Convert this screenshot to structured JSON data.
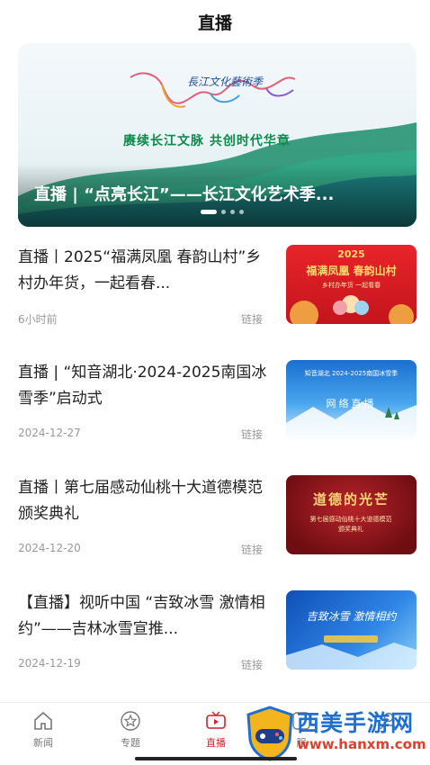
{
  "header": {
    "title": "直播"
  },
  "banner": {
    "caption": "直播 | “点亮长江”——长江文化艺术季...",
    "slogan": "赓续长江文脉  共创时代华章",
    "logo_text": "長江文化藝術季",
    "slide_count": 4,
    "active_slide": 1
  },
  "news": [
    {
      "title": "直播丨2025“福满凤凰 春韵山村”乡村办年货，一起看春...",
      "time": "6小时前",
      "tag": "链接",
      "thumb": {
        "headline": "福满凤凰 春韵山村",
        "year": "2025",
        "sub": "乡村办年货  一起看春",
        "theme": "red-festival"
      }
    },
    {
      "title": "直播 | “知音湖北·2024-2025南国冰雪季”启动式",
      "time": "2024-12-27",
      "tag": "链接",
      "thumb": {
        "headline": "知音湖北  2024-2025南国冰雪季",
        "sub": "网络直播",
        "theme": "blue-snow"
      }
    },
    {
      "title": "直播丨第七届感动仙桃十大道德模范颁奖典礼",
      "time": "2024-12-20",
      "tag": "链接",
      "thumb": {
        "headline": "道德的光芒",
        "sub": "第七届感动仙桃十大道德模范 颁奖典礼",
        "theme": "dark-red-stage"
      }
    },
    {
      "title": "【直播】视听中国 “吉致冰雪 激情相约”——吉林冰雪宣推...",
      "time": "2024-12-19",
      "tag": "链接",
      "thumb": {
        "headline": "吉致冰雪 激情相约",
        "sub": "",
        "theme": "blue-ice"
      }
    }
  ],
  "tabbar": {
    "items": [
      {
        "label": "新闻",
        "icon": "home-icon",
        "active": false
      },
      {
        "label": "专题",
        "icon": "star-icon",
        "active": false
      },
      {
        "label": "直播",
        "icon": "live-tv-icon",
        "active": true
      },
      {
        "label": "服",
        "icon": "service-icon",
        "active": false
      },
      {
        "label": "",
        "icon": "user-icon",
        "active": false
      }
    ]
  },
  "watermark": {
    "title": "西美手游网",
    "url": "www.hanxm.com"
  },
  "colors": {
    "accent": "#d61f26",
    "text": "#222222",
    "meta": "#999999",
    "watermark_blue": "#1f6fd1",
    "watermark_red": "#e23d2d"
  }
}
